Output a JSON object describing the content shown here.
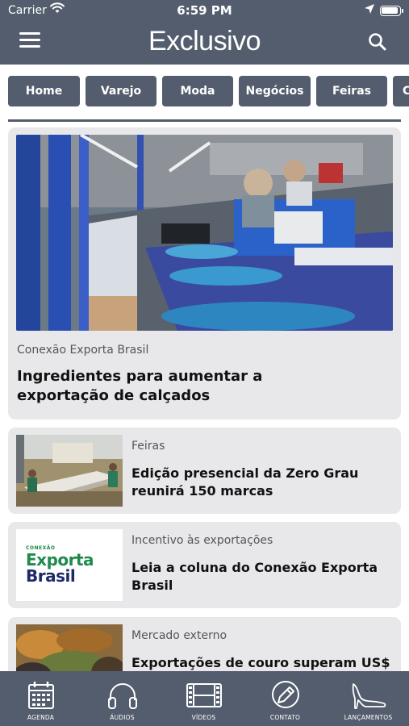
{
  "status_bar": {
    "carrier": "Carrier",
    "time": "6:59 PM"
  },
  "header": {
    "title": "Exclusivo",
    "menu_icon": "hamburger-menu-icon",
    "search_icon": "search-icon"
  },
  "tabs": [
    {
      "label": "Home"
    },
    {
      "label": "Varejo"
    },
    {
      "label": "Moda"
    },
    {
      "label": "Negócios"
    },
    {
      "label": "Feiras"
    },
    {
      "label": "C"
    }
  ],
  "featured": {
    "category": "Conexão Exporta Brasil",
    "headline": "Ingredientes para aumentar a exportação de calçados"
  },
  "articles": [
    {
      "category": "Feiras",
      "headline": "Edição presencial da Zero Grau reunirá 150 marcas"
    },
    {
      "category": "Incentivo às exportações",
      "headline": "Leia a coluna do Conexão Exporta Brasil",
      "logo": {
        "small": "CONEXÃO",
        "line1": "Exporta",
        "line2": "Brasil"
      }
    },
    {
      "category": "Mercado externo",
      "headline": "Exportações de couro superam US$"
    }
  ],
  "bottom_nav": [
    {
      "label": "AGENDA",
      "icon": "calendar-icon"
    },
    {
      "label": "ÁUDIOS",
      "icon": "headphones-icon"
    },
    {
      "label": "VÍDEOS",
      "icon": "film-icon"
    },
    {
      "label": "CONTATO",
      "icon": "pen-icon"
    },
    {
      "label": "LANÇAMENTOS",
      "icon": "high-heel-icon"
    }
  ],
  "colors": {
    "primary": "#545d6d",
    "card_bg": "#e8e8ea",
    "logo_green": "#1f8a4c",
    "logo_navy": "#1e2a66"
  }
}
